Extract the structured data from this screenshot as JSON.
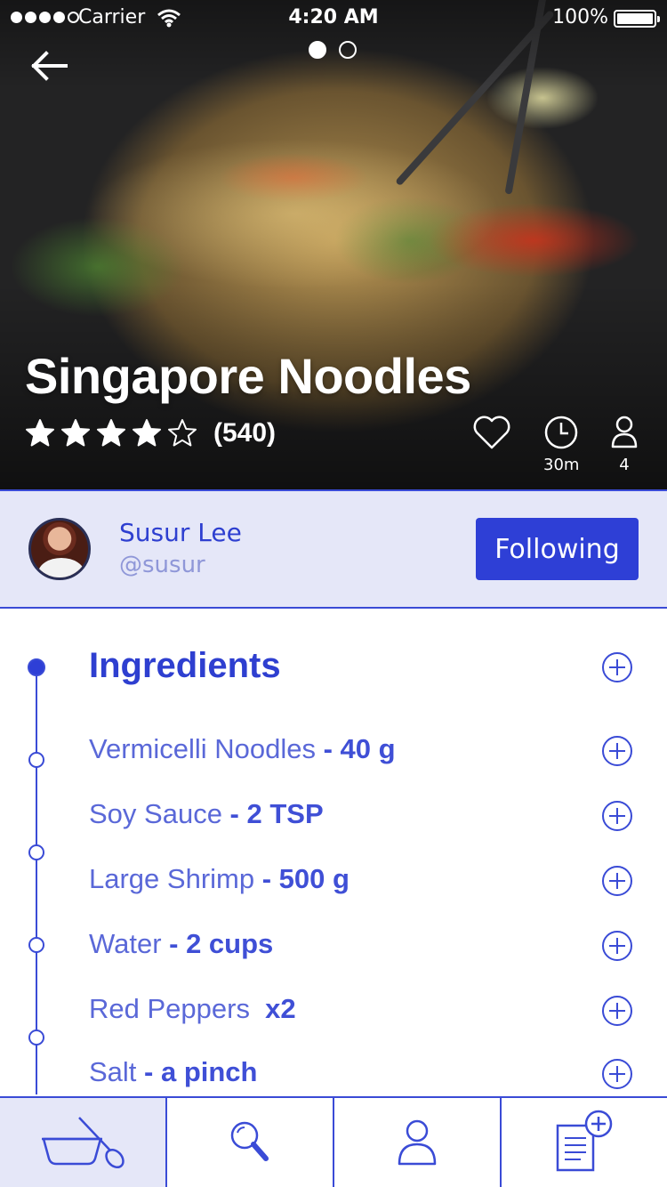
{
  "status_bar": {
    "carrier": "Carrier",
    "time": "4:20 AM",
    "battery": "100%"
  },
  "recipe": {
    "title": "Singapore Noodles",
    "rating": 4,
    "rating_count": "(540)",
    "time": "30m",
    "servings": "4"
  },
  "author": {
    "name": "Susur Lee",
    "handle": "@susur",
    "follow_label": "Following"
  },
  "ingredients": {
    "heading": "Ingredients",
    "items": [
      {
        "name": "Vermicelli Noodles",
        "qty": " - 40 g"
      },
      {
        "name": "Soy Sauce",
        "qty": " - 2 TSP"
      },
      {
        "name": "Large Shrimp",
        "qty": " - 500 g"
      },
      {
        "name": "Water",
        "qty": " - 2 cups"
      },
      {
        "name": "Red Peppers",
        "qty": "  x2"
      },
      {
        "name": "Salt",
        "qty": " - a pinch"
      }
    ]
  },
  "tabs": [
    {
      "icon": "bowl-spoon-icon",
      "active": true
    },
    {
      "icon": "search-icon",
      "active": false
    },
    {
      "icon": "profile-icon",
      "active": false
    },
    {
      "icon": "add-list-icon",
      "active": false
    }
  ],
  "colors": {
    "accent": "#2e3fd6",
    "author_bg": "#e5e7f8",
    "ingredient_text": "#5a68d8"
  }
}
